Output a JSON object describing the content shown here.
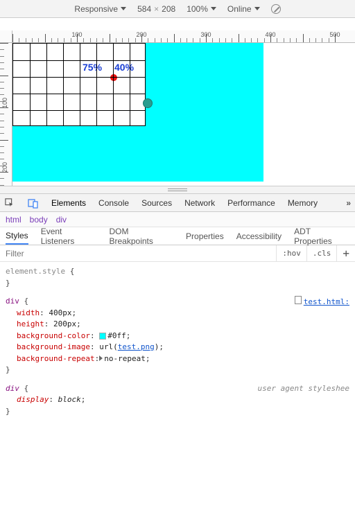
{
  "toolbar": {
    "device_mode": "Responsive",
    "width": "584",
    "height": "208",
    "zoom": "100%",
    "throttle": "Online"
  },
  "rulers": {
    "h_labels": [
      "100",
      "200",
      "300",
      "400",
      "500"
    ],
    "v_labels": [
      "100",
      "200"
    ]
  },
  "preview": {
    "pct_left": "75%",
    "pct_right": "40%"
  },
  "panel_tabs": [
    "Elements",
    "Console",
    "Sources",
    "Network",
    "Performance",
    "Memory"
  ],
  "panel_tabs_active": 0,
  "breadcrumb": [
    "html",
    "body",
    "div"
  ],
  "sub_tabs": [
    "Styles",
    "Event Listeners",
    "DOM Breakpoints",
    "Properties",
    "Accessibility",
    "ADT Properties"
  ],
  "sub_tabs_active": 0,
  "filter": {
    "placeholder": "Filter",
    "hov": ":hov",
    "cls": ".cls"
  },
  "styles": {
    "element_style": {
      "selector": "element.style",
      "props": []
    },
    "rule1": {
      "selector": "div",
      "source": "test.html:",
      "props": [
        {
          "name": "width",
          "value": "400px"
        },
        {
          "name": "height",
          "value": "200px"
        },
        {
          "name": "background-color",
          "value": "#0ff",
          "swatch": "#00ffff"
        },
        {
          "name": "background-image",
          "value_prefix": "url(",
          "url": "test.png",
          "value_suffix": ")"
        },
        {
          "name": "background-repeat",
          "value": "no-repeat",
          "expand": true
        }
      ]
    },
    "ua_rule": {
      "selector": "div",
      "note": "user agent styleshee",
      "props": [
        {
          "name": "display",
          "value": "block"
        }
      ]
    }
  }
}
